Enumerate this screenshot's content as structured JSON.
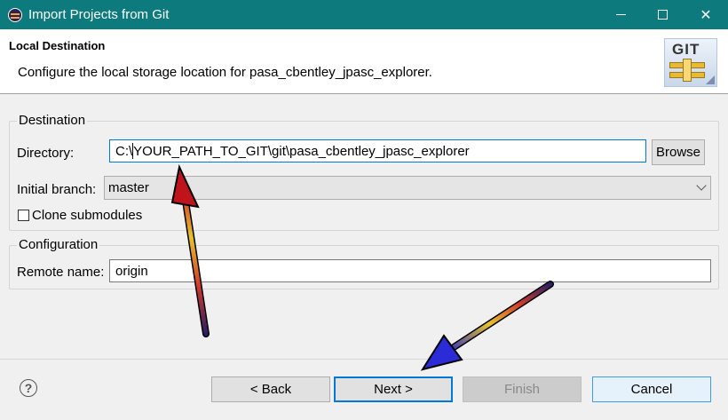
{
  "window": {
    "title": "Import Projects from Git",
    "minimize": "–",
    "maximize": "□",
    "close": "✕"
  },
  "header": {
    "title": "Local Destination",
    "description": "Configure the local storage location for pasa_cbentley_jpasc_explorer.",
    "logo_text": "GIT"
  },
  "destination": {
    "group_label": "Destination",
    "directory_label": "Directory:",
    "directory_prefix": "C:\\",
    "directory_rest": "YOUR_PATH_TO_GIT\\git\\pasa_cbentley_jpasc_explorer",
    "browse_label": "Browse",
    "branch_label": "Initial branch:",
    "branch_value": "master",
    "clone_submodules_label": "Clone submodules",
    "clone_submodules_checked": false
  },
  "configuration": {
    "group_label": "Configuration",
    "remote_label": "Remote name:",
    "remote_value": "origin"
  },
  "footer": {
    "help_icon": "?",
    "back_label": "< Back",
    "next_label": "Next >",
    "finish_label": "Finish",
    "cancel_label": "Cancel"
  },
  "icons": {
    "app": "eclipse-icon",
    "logo": "git-logo-icon",
    "help": "help-icon",
    "arrows": "annotation-arrows"
  },
  "colors": {
    "titlebar": "#0d7b7d",
    "focus_border": "#0078d7"
  }
}
